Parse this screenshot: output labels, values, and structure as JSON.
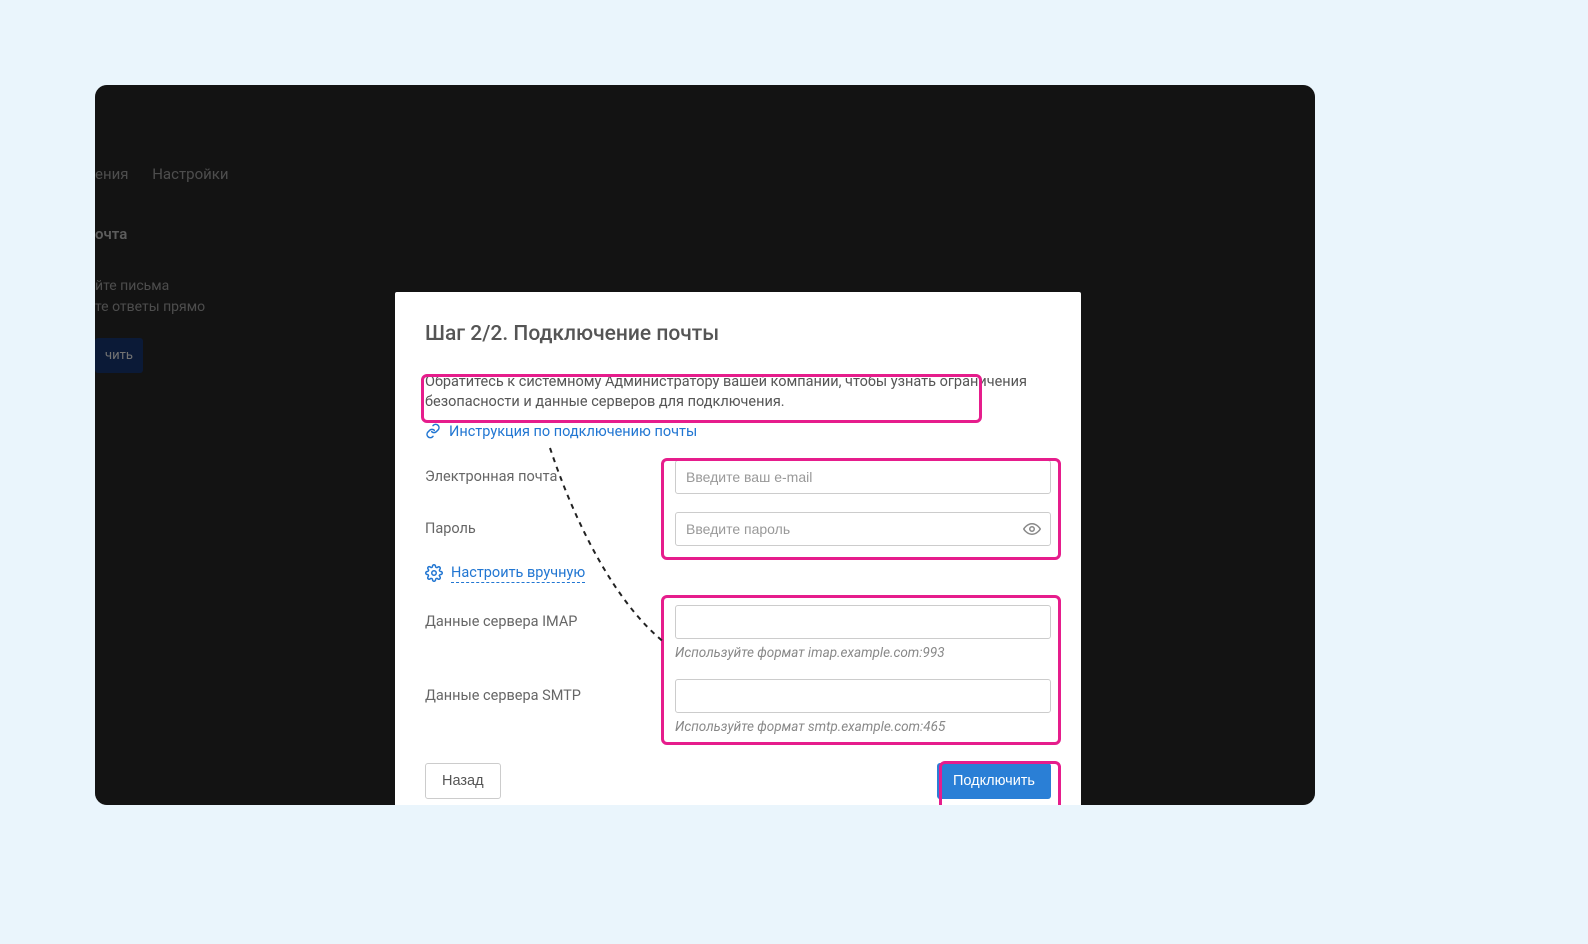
{
  "background": {
    "nav_item_1": "ения",
    "nav_item_2": "Настройки",
    "side_title": "очта",
    "side_line_1": "йте письма",
    "side_line_2": "те ответы прямо",
    "side_button": "чить"
  },
  "modal": {
    "title": "Шаг 2/2. Подключение почты",
    "info_text": "Обратитесь к системному Администратору вашей компании, чтобы узнать ограничения безопасности и данные серверов для подключения.",
    "instruction_link": "Инструкция по подключению почты",
    "email_label": "Электронная почта",
    "email_placeholder": "Введите ваш e-mail",
    "password_label": "Пароль",
    "password_placeholder": "Введите пароль",
    "manual_link": "Настроить вручную",
    "imap_label": "Данные сервера IMAP",
    "imap_hint": "Используйте формат imap.example.com:993",
    "smtp_label": "Данные сервера SMTP",
    "smtp_hint": "Используйте формат smtp.example.com:465",
    "back_button": "Назад",
    "submit_button": "Подключить"
  }
}
